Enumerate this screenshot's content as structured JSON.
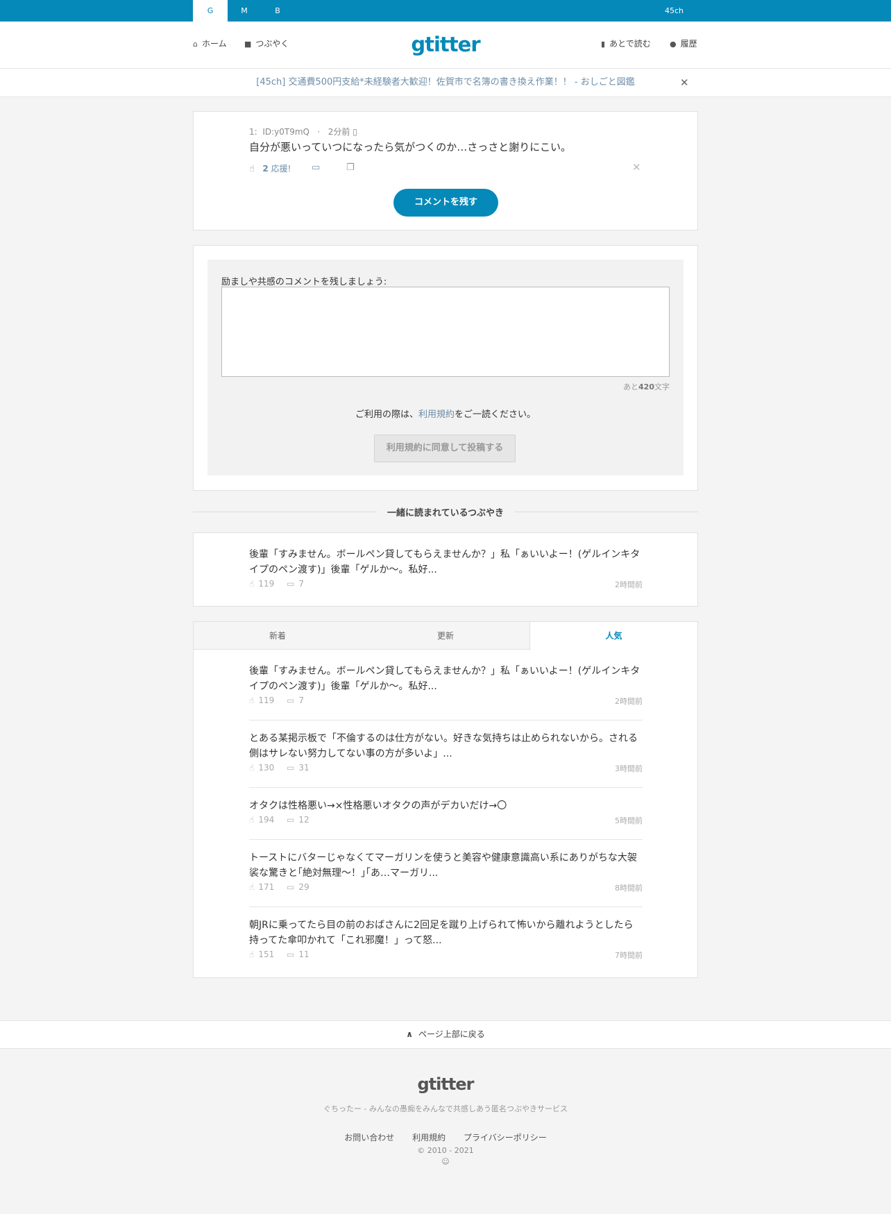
{
  "topbar": {
    "tabs": [
      {
        "label": "G",
        "active": true
      },
      {
        "label": "M",
        "active": false
      },
      {
        "label": "B",
        "active": false
      }
    ],
    "right_label": "45ch"
  },
  "header": {
    "logo": "gtitter",
    "nav_left": [
      {
        "label": "ホーム",
        "icon": "home-icon"
      },
      {
        "label": "つぶやく",
        "icon": "speech-bubble-icon"
      }
    ],
    "nav_right": [
      {
        "label": "あとで読む",
        "icon": "bookmark-icon"
      },
      {
        "label": "履歴",
        "icon": "user-icon"
      }
    ]
  },
  "notice": {
    "text": "[45ch] 交通費500円支給*未経験者大歓迎！佐賀市で名簿の書き換え作業！！ - おしごと図鑑"
  },
  "post": {
    "number": "1:",
    "id": "ID:y0T9mQ",
    "dot": "·",
    "time": "2分前",
    "text": "自分が悪いっていつになったら気がつくのか…さっさと謝りにこい。",
    "cheer_count": "2",
    "cheer_label": "応援!",
    "comment_button": "コメントを残す"
  },
  "comment_form": {
    "label": "励ましや共感のコメントを残しましょう:",
    "textarea_value": "",
    "counter_prefix": "あと",
    "counter_value": "420",
    "counter_suffix": "文字",
    "terms_before": "ご利用の際は、",
    "terms_link": "利用規約",
    "terms_after": "をご一読ください。",
    "submit_label": "利用規約に同意して投稿する"
  },
  "related": {
    "heading": "一緒に読まれているつぶやき",
    "items": [
      {
        "line1": "後輩「すみません。ボールペン貸してもらえませんか？」私「ぁいいよー！(ゲルインキタ",
        "line2": "イプのペン渡す)」後輩「ゲルか〜。私好...",
        "likes": "119",
        "comments": "7",
        "time": "2時間前"
      }
    ]
  },
  "ranking": {
    "tabs": [
      {
        "label": "新着",
        "active": false
      },
      {
        "label": "更新",
        "active": false
      },
      {
        "label": "人気",
        "active": true
      }
    ],
    "items": [
      {
        "line1": "後輩「すみません。ボールペン貸してもらえませんか？」私「ぁいいよー！(ゲルインキタ",
        "line2": "イプのペン渡す)」後輩「ゲルか〜。私好...",
        "likes": "119",
        "comments": "7",
        "time": "2時間前"
      },
      {
        "line1": "とある某掲示板で「不倫するのは仕方がない。好きな気持ちは止められないから。される",
        "line2": "側はサレない努力してない事の方が多いよ」...",
        "likes": "130",
        "comments": "31",
        "time": "3時間前"
      },
      {
        "line1": "オタクは性格悪い→×性格悪いオタクの声がデカいだけ→〇",
        "line2": "",
        "likes": "194",
        "comments": "12",
        "time": "5時間前"
      },
      {
        "line1": "トーストにバターじゃなくてマーガリンを使うと美容や健康意識高い系にありがちな大袈",
        "line2": "裟な驚きと｢絶対無理～！｣｢あ…マーガリ...",
        "likes": "171",
        "comments": "29",
        "time": "8時間前"
      },
      {
        "line1": "朝JRに乗ってたら目の前のおばさんに2回足を蹴り上げられて怖いから離れようとしたら",
        "line2": "持ってた傘叩かれて「これ邪魔！」って怒...",
        "likes": "151",
        "comments": "11",
        "time": "7時間前"
      }
    ]
  },
  "to_top": {
    "label": "ページ上部に戻る"
  },
  "footer": {
    "logo": "gtitter",
    "tagline": "ぐちったー - みんなの愚痴をみんなで共感しあう匿名つぶやきサービス",
    "links": [
      "お問い合わせ",
      "利用規約",
      "プライバシーポリシー"
    ],
    "copyright": "© 2010 - 2021"
  },
  "colors": {
    "brand": "#0589b9",
    "link": "#6d8da8",
    "background": "#f4f4f4"
  }
}
